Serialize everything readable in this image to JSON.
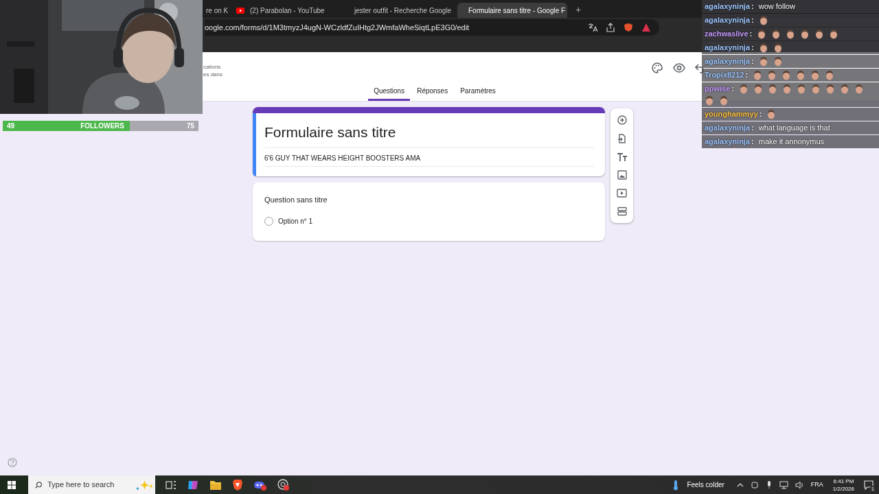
{
  "followers": {
    "current": "49",
    "label": "FOLLOWERS",
    "goal": "75",
    "level": 0.65
  },
  "browser": {
    "tabs": [
      {
        "title": "re on K",
        "kind": "plain",
        "selected": false
      },
      {
        "title": "(2) Parabolan - YouTube",
        "kind": "video",
        "selected": false
      },
      {
        "title": "jester outfit - Recherche Google",
        "kind": "search",
        "selected": false
      },
      {
        "title": "Formulaire sans titre - Google F",
        "kind": "form",
        "selected": true
      }
    ],
    "new_tab": "+",
    "address": "oogle.com/forms/d/1M3tmyzJ4ugN-WCzldfZuIHtg2JWmfaWheSiqtLpE3G0/edit"
  },
  "forms_header": {
    "partial_lines": [
      "cations",
      "es dans"
    ],
    "tabs": [
      {
        "label": "Questions",
        "selected": true
      },
      {
        "label": "Réponses",
        "selected": false
      },
      {
        "label": "Paramètres",
        "selected": false
      }
    ]
  },
  "form": {
    "title": "Formulaire sans titre",
    "description": "6'6 GUY THAT WEARS HEIGHT BOOSTERS AMA"
  },
  "question": {
    "title": "Question sans titre",
    "options": [
      {
        "label": "Option n° 1",
        "selected": false
      }
    ]
  },
  "chat": [
    {
      "user": "agalaxyninja",
      "color": "#9cc6ff",
      "separator": ":",
      "parts": [
        {
          "kind": "text",
          "text": "wow follow"
        }
      ]
    },
    {
      "user": "agalaxyninja",
      "color": "#9cc6ff",
      "separator": ":",
      "parts": [
        {
          "kind": "emote"
        }
      ]
    },
    {
      "user": "zachwaslive",
      "color": "#c79aff",
      "separator": ":",
      "parts": [
        {
          "kind": "emote"
        },
        {
          "kind": "emote"
        },
        {
          "kind": "emote"
        },
        {
          "kind": "emote"
        },
        {
          "kind": "emote"
        },
        {
          "kind": "emote"
        }
      ]
    },
    {
      "user": "agalaxyninja",
      "color": "#9cc6ff",
      "separator": ":",
      "parts": [
        {
          "kind": "emote"
        },
        {
          "kind": "emote"
        }
      ]
    },
    {
      "user": "agalaxyninja",
      "color": "#9cc6ff",
      "separator": ":",
      "parts": [
        {
          "kind": "emote"
        },
        {
          "kind": "emote"
        }
      ]
    },
    {
      "user": "Tropix8212",
      "color": "#9cc6ff",
      "separator": ":",
      "parts": [
        {
          "kind": "emote"
        },
        {
          "kind": "emote"
        },
        {
          "kind": "emote"
        },
        {
          "kind": "emote"
        },
        {
          "kind": "emote"
        },
        {
          "kind": "emote"
        }
      ]
    },
    {
      "user": "ppwise",
      "color": "#c79aff",
      "separator": ":",
      "parts": [
        {
          "kind": "emote"
        },
        {
          "kind": "emote"
        },
        {
          "kind": "emote"
        },
        {
          "kind": "emote"
        },
        {
          "kind": "emote"
        },
        {
          "kind": "emote"
        },
        {
          "kind": "emote"
        },
        {
          "kind": "emote"
        },
        {
          "kind": "emote"
        },
        {
          "kind": "emote"
        },
        {
          "kind": "emote"
        }
      ]
    },
    {
      "user": "younghammyy",
      "color": "#ffc240",
      "separator": ":",
      "parts": [
        {
          "kind": "emote"
        }
      ]
    },
    {
      "user": "agalaxyninja",
      "color": "#9cc6ff",
      "separator": ":",
      "parts": [
        {
          "kind": "text",
          "text": "what language is that"
        }
      ]
    },
    {
      "user": "agalaxyninja",
      "color": "#9cc6ff",
      "separator": ":",
      "parts": [
        {
          "kind": "text",
          "text": "make it annonymus"
        }
      ]
    }
  ],
  "taskbar": {
    "search_placeholder": "Type here to search",
    "weather": "Feels colder",
    "language": "FRA",
    "time": "6:41 PM",
    "date": "1/2/2026",
    "notifications": "1"
  }
}
